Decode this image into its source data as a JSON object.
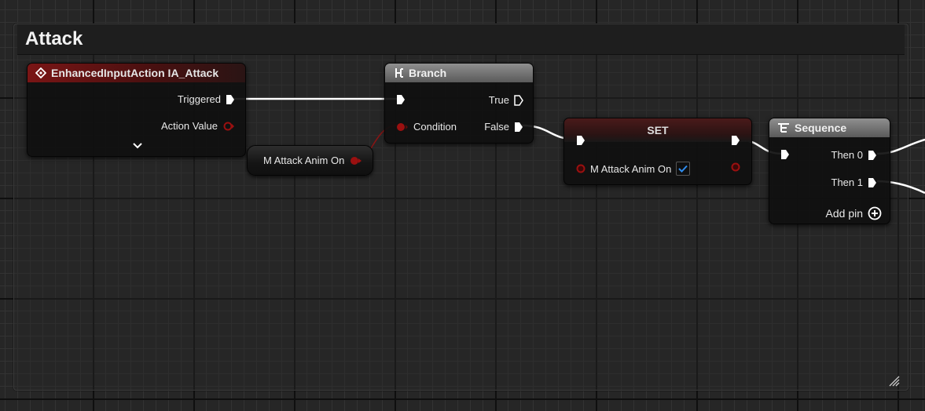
{
  "comment": {
    "title": "Attack"
  },
  "nodes": {
    "input_action": {
      "title": "EnhancedInputAction IA_Attack",
      "pins": {
        "triggered": "Triggered",
        "action_value": "Action Value"
      }
    },
    "getter": {
      "label": "M Attack Anim On"
    },
    "branch": {
      "title": "Branch",
      "pins": {
        "true": "True",
        "condition": "Condition",
        "false": "False"
      }
    },
    "set": {
      "title": "SET",
      "pins": {
        "variable": "M Attack Anim On",
        "checked": true
      }
    },
    "sequence": {
      "title": "Sequence",
      "pins": {
        "then0": "Then 0",
        "then1": "Then 1",
        "add_pin": "Add pin"
      }
    }
  },
  "colors": {
    "exec_wire": "#ffffff",
    "bool_wire": "#8a1414",
    "bool_pin": "#9b1010",
    "checkbox_check": "#2f8df0"
  }
}
